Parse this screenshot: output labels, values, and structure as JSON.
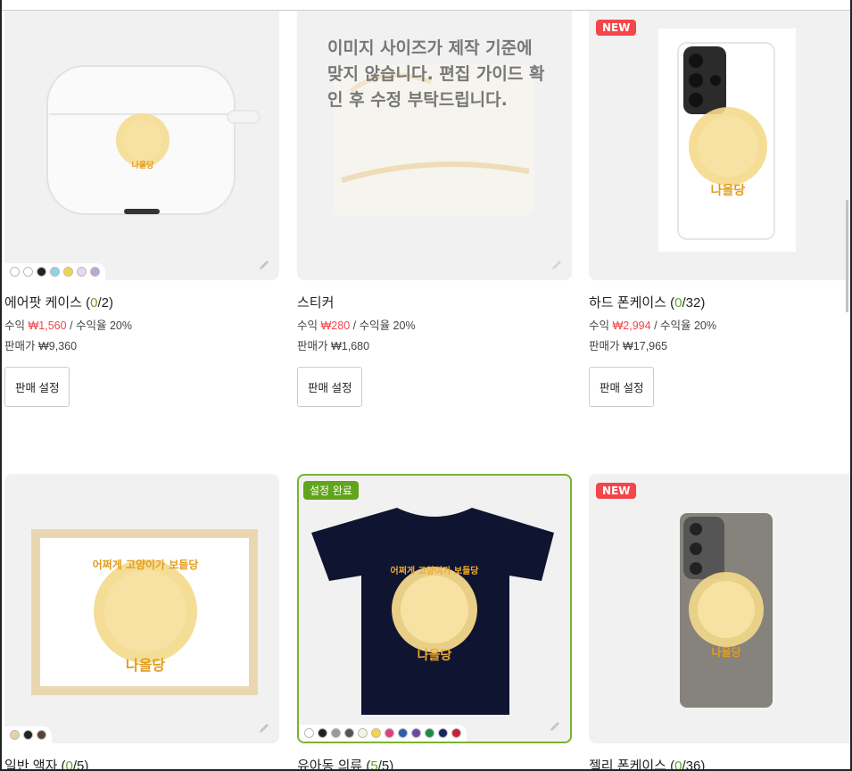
{
  "products": [
    {
      "title": "에어팟 케이스",
      "count_open": " (",
      "count": "0",
      "count_total": "/2)",
      "profit_label": "수익",
      "profit": "₩1,560",
      "rate": " / 수익율 20%",
      "price_label": "판매가",
      "price": "₩9,360",
      "button": "판매 설정"
    },
    {
      "title": "스티커",
      "count_open": "",
      "count": "",
      "count_total": "",
      "profit_label": "수익",
      "profit": "₩280",
      "rate": " / 수익율 20%",
      "price_label": "판매가",
      "price": "₩1,680",
      "button": "판매 설정",
      "warning": "이미지 사이즈가 제작 기준에 맞지 않습니다. 편집 가이드 확인 후 수정 부탁드립니다."
    },
    {
      "badge": "NEW",
      "title": "하드 폰케이스",
      "count_open": " (",
      "count": "0",
      "count_total": "/32)",
      "profit_label": "수익",
      "profit": "₩2,994",
      "rate": " / 수익율 20%",
      "price_label": "판매가",
      "price": "₩17,965",
      "button": "판매 설정"
    },
    {
      "title": "일반 액자",
      "count_open": " (",
      "count": "0",
      "count_total": "/5)"
    },
    {
      "badge": "설정 완료",
      "title": "유아동 의류",
      "count_open": " (",
      "count": "5",
      "count_total": "/5)"
    },
    {
      "badge": "NEW",
      "title": "젤리 폰케이스",
      "count_open": " (",
      "count": "0",
      "count_total": "/36)"
    }
  ],
  "artwork": {
    "arc_text": "어쩌게 고양이가 보들당",
    "logo_text": "나올당"
  },
  "swatch_colors": {
    "airpod": [
      "#ffffff",
      "#ffffff",
      "#222222",
      "#8fd3ea",
      "#f4d54a",
      "#e9d7ef",
      "#b8a8d8"
    ],
    "frame": [
      "#e7d2a8",
      "#222222",
      "#5b4434"
    ],
    "tshirt": [
      "#ffffff",
      "#222222",
      "#999999",
      "#555555",
      "#f7f2dc",
      "#f4d54a",
      "#e0407f",
      "#2e5fae",
      "#6b4aa0",
      "#1b8a4c",
      "#18285a",
      "#c8203a"
    ]
  }
}
